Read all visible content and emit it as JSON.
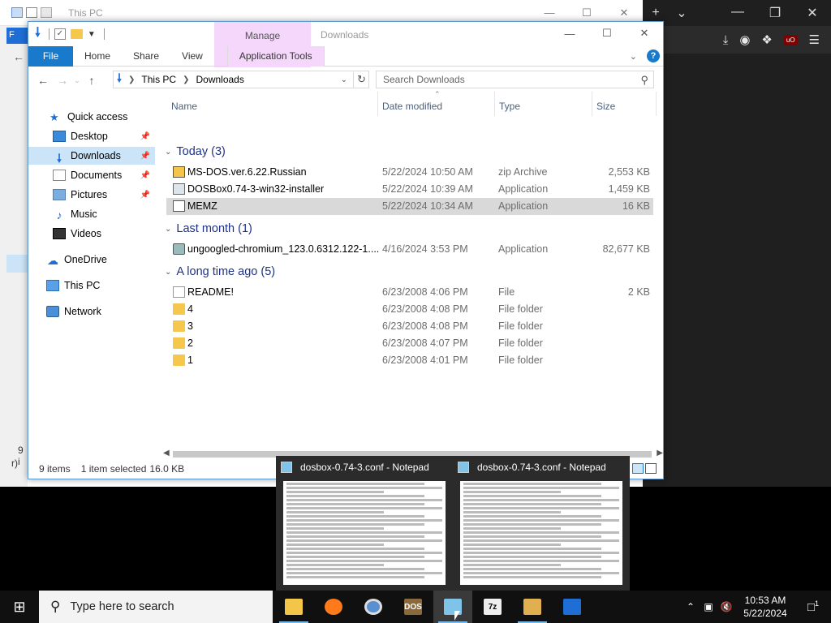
{
  "background_window": {
    "title": "This PC",
    "side_letter": "F",
    "status_left_1": "9 i",
    "status_left_2": "r)"
  },
  "browser": {
    "tab_add": "+",
    "tab_list": "⌄"
  },
  "explorer": {
    "title": "Downloads",
    "context_tab": "Manage",
    "ribbon_tabs": [
      "File",
      "Home",
      "Share",
      "View",
      "Application Tools"
    ],
    "address": {
      "crumbs": [
        "This PC",
        "Downloads"
      ]
    },
    "search_placeholder": "Search Downloads",
    "nav_items": [
      {
        "label": "Quick access",
        "icon": "star-icon"
      },
      {
        "label": "Desktop",
        "icon": "desktop-icon",
        "pinned": true
      },
      {
        "label": "Downloads",
        "icon": "download-arrow-icon",
        "pinned": true,
        "selected": true
      },
      {
        "label": "Documents",
        "icon": "documents-icon",
        "pinned": true
      },
      {
        "label": "Pictures",
        "icon": "pictures-icon",
        "pinned": true
      },
      {
        "label": "Music",
        "icon": "music-icon"
      },
      {
        "label": "Videos",
        "icon": "videos-icon"
      },
      {
        "label": "OneDrive",
        "icon": "cloud-icon"
      },
      {
        "label": "This PC",
        "icon": "computer-icon"
      },
      {
        "label": "Network",
        "icon": "network-icon"
      }
    ],
    "columns": [
      "Name",
      "Date modified",
      "Type",
      "Size"
    ],
    "groups": [
      {
        "label": "Today (3)"
      },
      {
        "label": "Last month (1)"
      },
      {
        "label": "A long time ago (5)"
      }
    ],
    "files": [
      {
        "name": "MS-DOS.ver.6.22.Russian",
        "date": "5/22/2024 10:50 AM",
        "type": "zip Archive",
        "size": "2,553 KB",
        "icon": "zip-icon"
      },
      {
        "name": "DOSBox0.74-3-win32-installer",
        "date": "5/22/2024 10:39 AM",
        "type": "Application",
        "size": "1,459 KB",
        "icon": "installer-icon"
      },
      {
        "name": "MEMZ",
        "date": "5/22/2024 10:34 AM",
        "type": "Application",
        "size": "16 KB",
        "icon": "application-icon",
        "selected": true
      },
      {
        "name": "ungoogled-chromium_123.0.6312.122-1....",
        "date": "4/16/2024 3:53 PM",
        "type": "Application",
        "size": "82,677 KB",
        "icon": "installer-icon"
      },
      {
        "name": "README!",
        "date": "6/23/2008 4:06 PM",
        "type": "File",
        "size": "2 KB",
        "icon": "file-icon"
      },
      {
        "name": "4",
        "date": "6/23/2008 4:08 PM",
        "type": "File folder",
        "size": "",
        "icon": "folder-icon"
      },
      {
        "name": "3",
        "date": "6/23/2008 4:08 PM",
        "type": "File folder",
        "size": "",
        "icon": "folder-icon"
      },
      {
        "name": "2",
        "date": "6/23/2008 4:07 PM",
        "type": "File folder",
        "size": "",
        "icon": "folder-icon"
      },
      {
        "name": "1",
        "date": "6/23/2008 4:01 PM",
        "type": "File folder",
        "size": "",
        "icon": "folder-icon"
      }
    ],
    "status": {
      "count": "9 items",
      "selected": "1 item selected",
      "size": "16.0 KB"
    }
  },
  "previews": [
    {
      "title": "dosbox-0.74-3.conf - Notepad"
    },
    {
      "title": "dosbox-0.74-3.conf - Notepad"
    }
  ],
  "taskbar": {
    "search_placeholder": "Type here to search",
    "apps": [
      {
        "name": "File Explorer",
        "icon": "folder-icon",
        "running": true
      },
      {
        "name": "Firefox",
        "icon": "firefox-icon"
      },
      {
        "name": "Chrome",
        "icon": "chrome-icon"
      },
      {
        "name": "DOSBox",
        "icon": "dosbox-icon",
        "glyph": "DOS"
      },
      {
        "name": "Notepad",
        "icon": "notepad-icon",
        "running": true,
        "active": true
      },
      {
        "name": "7-Zip",
        "icon": "7zip-icon",
        "glyph": "7z"
      },
      {
        "name": "On-Screen Keyboard",
        "icon": "keyboard-icon",
        "running": true
      },
      {
        "name": "WordPad",
        "icon": "wordpad-icon"
      }
    ],
    "time": "10:53 AM",
    "date": "5/22/2024",
    "notifications": "1"
  }
}
